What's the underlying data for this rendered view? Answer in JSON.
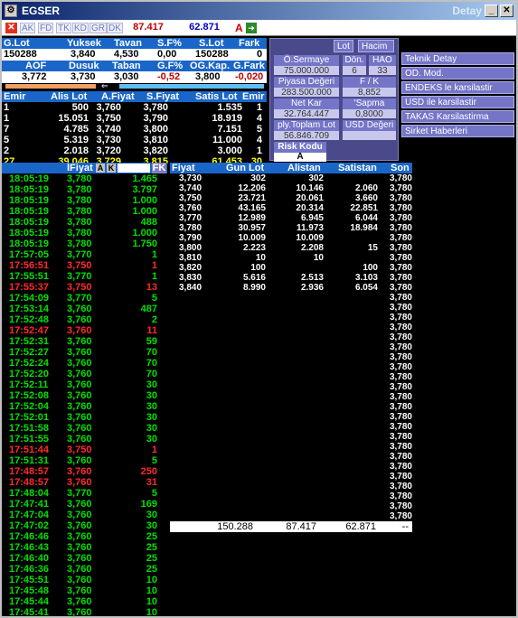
{
  "window": {
    "title": "EGSER",
    "right_title": "Detay",
    "buttons": {
      "minimize": "_",
      "maximize": "□",
      "close": "✕"
    }
  },
  "toolbar": {
    "close_label": "✕",
    "tabs": [
      "AK",
      "FD",
      "TK",
      "KD",
      "GR",
      "DK"
    ],
    "field1": "87.417",
    "field2": "62.871",
    "a_label": "A",
    "go_label": "➜"
  },
  "summary": {
    "row1_headers": [
      "G.Lot",
      "Yuksek",
      "Tavan",
      "S.F%",
      "S.Lot",
      "Fark"
    ],
    "row1_values": [
      "150288",
      "3,840",
      "4,530",
      "0,00",
      "150288",
      "0"
    ],
    "row2_headers": [
      "AOF",
      "Dusuk",
      "Taban",
      "G.F%",
      "OG.Kap.",
      "G.Fark"
    ],
    "row2_values": [
      "3,772",
      "3,730",
      "3,030",
      "-0,52",
      "3,800",
      "-0,020"
    ]
  },
  "info_panel": {
    "lot_btn": "Lot",
    "hacim_btn": "Hacim",
    "o_sermaye_label": "Ö.Sermaye",
    "o_sermaye_value": "75.000.000",
    "don_label": "Dön.",
    "don_value": "6",
    "hao_label": "HAO",
    "hao_value": "33",
    "piyasa_label": "Piyasa Değeri",
    "piyasa_value": "283.500.000",
    "fk_label": "F / K",
    "fk_value": "8,852",
    "net_kar_label": "Net Kar",
    "net_kar_value": "32.764.447",
    "sapma_label": "'Sapma",
    "sapma_value": "0,8000",
    "ply_label": "ply.Toplam Lot",
    "ply_value": "56.846.709",
    "usd_label": "USD Değeri",
    "usd_value": "",
    "risk_label": "Risk Kodu",
    "risk_value": "A"
  },
  "side_menu": [
    "Teknik Detay",
    "OD. Mod.",
    "ENDEKS le karsilastir",
    "USD ile karsilastir",
    "TAKAS Karsilastirma",
    "Sirket Haberleri"
  ],
  "orderbook": {
    "headers": [
      "Emir",
      "Alis Lot",
      "A.Fiyat",
      "S.Fiyat",
      "Satis Lot",
      "Emir"
    ],
    "rows": [
      [
        "1",
        "500",
        "3,760",
        "3,780",
        "1.535",
        "1"
      ],
      [
        "1",
        "15.051",
        "3,750",
        "3,790",
        "18.919",
        "4"
      ],
      [
        "7",
        "4.785",
        "3,740",
        "3,800",
        "7.151",
        "5"
      ],
      [
        "5",
        "5.319",
        "3,730",
        "3,810",
        "11.000",
        "4"
      ],
      [
        "2",
        "2.018",
        "3,720",
        "3,820",
        "3.000",
        "1"
      ]
    ],
    "totals": [
      "27",
      "39.046",
      "3,729",
      "3,815",
      "61.453",
      "30"
    ]
  },
  "trades": {
    "header_fiyat": "lFiyat",
    "header_a": "A",
    "header_k": "K",
    "header_fk": "FK",
    "rows": [
      [
        "18:05:19",
        "3,780",
        "1.465",
        "g"
      ],
      [
        "18:05:19",
        "3,780",
        "3.797",
        "g"
      ],
      [
        "18:05:19",
        "3,780",
        "1.000",
        "g"
      ],
      [
        "18:05:19",
        "3,780",
        "1.000",
        "g"
      ],
      [
        "18:05:19",
        "3,780",
        "488",
        "g"
      ],
      [
        "18:05:19",
        "3,780",
        "1.000",
        "g"
      ],
      [
        "18:05:19",
        "3,780",
        "1.750",
        "g"
      ],
      [
        "17:57:05",
        "3,770",
        "1",
        "g"
      ],
      [
        "17:56:51",
        "3,750",
        "1",
        "rd"
      ],
      [
        "17:55:51",
        "3,770",
        "1",
        "g"
      ],
      [
        "17:55:37",
        "3,750",
        "13",
        "rd"
      ],
      [
        "17:54:09",
        "3,770",
        "5",
        "g"
      ],
      [
        "17:53:14",
        "3,760",
        "487",
        "g"
      ],
      [
        "17:52:48",
        "3,760",
        "2",
        "g"
      ],
      [
        "17:52:47",
        "3,760",
        "11",
        "rd"
      ],
      [
        "17:52:31",
        "3,760",
        "59",
        "g"
      ],
      [
        "17:52:27",
        "3,760",
        "70",
        "g"
      ],
      [
        "17:52:24",
        "3,760",
        "70",
        "g"
      ],
      [
        "17:52:20",
        "3,760",
        "70",
        "g"
      ],
      [
        "17:52:11",
        "3,760",
        "30",
        "g"
      ],
      [
        "17:52:08",
        "3,760",
        "30",
        "g"
      ],
      [
        "17:52:04",
        "3,760",
        "30",
        "g"
      ],
      [
        "17:52:01",
        "3,760",
        "30",
        "g"
      ],
      [
        "17:51:58",
        "3,760",
        "30",
        "g"
      ],
      [
        "17:51:55",
        "3,760",
        "30",
        "g"
      ],
      [
        "17:51:44",
        "3,750",
        "1",
        "rd"
      ],
      [
        "17:51:31",
        "3,760",
        "5",
        "g"
      ],
      [
        "17:48:57",
        "3,760",
        "250",
        "rd"
      ],
      [
        "17:48:57",
        "3,760",
        "31",
        "rd"
      ],
      [
        "17:48:04",
        "3,770",
        "5",
        "g"
      ],
      [
        "17:47:41",
        "3,760",
        "169",
        "g"
      ],
      [
        "17:47:04",
        "3,760",
        "30",
        "g"
      ],
      [
        "17:47:02",
        "3,760",
        "30",
        "g"
      ],
      [
        "17:46:46",
        "3,760",
        "25",
        "g"
      ],
      [
        "17:46:43",
        "3,760",
        "25",
        "g"
      ],
      [
        "17:46:40",
        "3,760",
        "25",
        "g"
      ],
      [
        "17:46:36",
        "3,760",
        "25",
        "g"
      ],
      [
        "17:45:51",
        "3,760",
        "10",
        "g"
      ],
      [
        "17:45:48",
        "3,760",
        "10",
        "g"
      ],
      [
        "17:45:44",
        "3,760",
        "10",
        "g"
      ],
      [
        "17:45:41",
        "3,760",
        "10",
        "g"
      ]
    ]
  },
  "depth": {
    "headers": [
      "Fiyat",
      "Gun Lot",
      "Alistan",
      "Satistan",
      "Son"
    ],
    "rows": [
      [
        "3,730",
        "302",
        "302",
        "",
        "3,780"
      ],
      [
        "3,740",
        "12.206",
        "10.146",
        "2.060",
        "3,780"
      ],
      [
        "3,750",
        "23.721",
        "20.061",
        "3.660",
        "3,780"
      ],
      [
        "3,760",
        "43.165",
        "20.314",
        "22.851",
        "3,780"
      ],
      [
        "3,770",
        "12.989",
        "6.945",
        "6.044",
        "3,780"
      ],
      [
        "3,780",
        "30.957",
        "11.973",
        "18.984",
        "3,780"
      ],
      [
        "3,790",
        "10.009",
        "10.009",
        "",
        "3,780"
      ],
      [
        "3,800",
        "2.223",
        "2.208",
        "15",
        "3,780"
      ],
      [
        "3,810",
        "10",
        "10",
        "",
        "3,780"
      ],
      [
        "3,820",
        "100",
        "",
        "100",
        "3,780"
      ],
      [
        "3,830",
        "5.616",
        "2.513",
        "3.103",
        "3,780"
      ],
      [
        "3,840",
        "8.990",
        "2.936",
        "6.054",
        "3,780"
      ]
    ],
    "son_extra": [
      "3,780",
      "3,780",
      "3,780",
      "3,780",
      "3,780",
      "3,780",
      "3,780",
      "3,780",
      "3,780",
      "3,780",
      "3,780",
      "3,780",
      "3,780",
      "3,780",
      "3,780",
      "3,780",
      "3,780",
      "3,780",
      "3,780",
      "3,780",
      "3,780",
      "3,780",
      "3,780"
    ],
    "totals": [
      "150.288",
      "87.417",
      "62.871",
      "--"
    ]
  }
}
